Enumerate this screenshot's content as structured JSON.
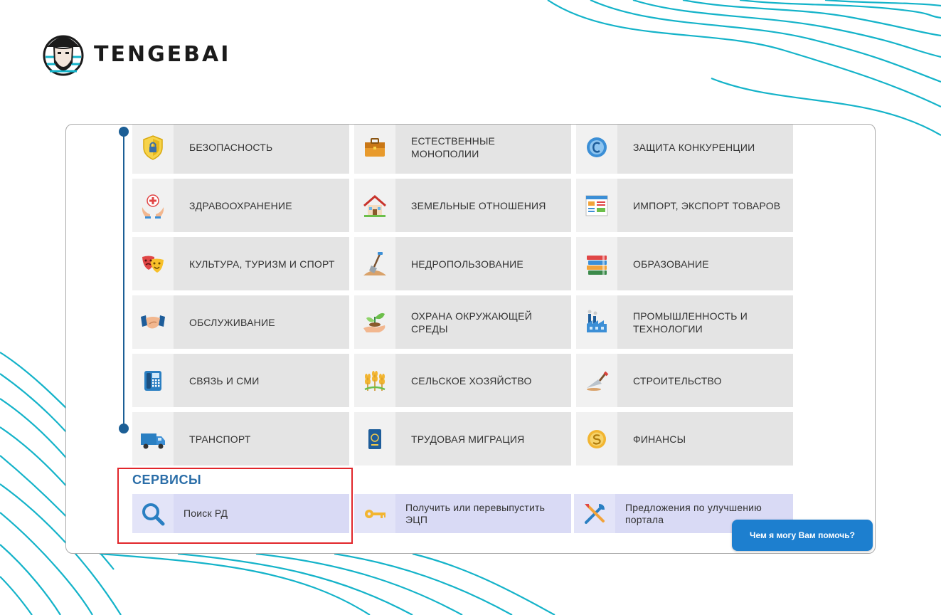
{
  "brand": {
    "name": "TENGEBAI"
  },
  "categories": [
    {
      "label": "БЕЗОПАСНОСТЬ",
      "icon": "shield-lock-icon"
    },
    {
      "label": "ЕСТЕСТВЕННЫЕ МОНОПОЛИИ",
      "icon": "briefcase-icon"
    },
    {
      "label": "ЗАЩИТА КОНКУРЕНЦИИ",
      "icon": "copyright-badge-icon"
    },
    {
      "label": "ЗДРАВООХРАНЕНИЕ",
      "icon": "medical-cross-hands-icon"
    },
    {
      "label": "ЗЕМЕЛЬНЫЕ ОТНОШЕНИЯ",
      "icon": "house-icon"
    },
    {
      "label": "ИМПОРТ, ЭКСПОРТ ТОВАРОВ",
      "icon": "document-list-icon"
    },
    {
      "label": "КУЛЬТУРА, ТУРИЗМ И СПОРТ",
      "icon": "theater-masks-icon"
    },
    {
      "label": "НЕДРОПОЛЬЗОВАНИЕ",
      "icon": "shovel-icon"
    },
    {
      "label": "ОБРАЗОВАНИЕ",
      "icon": "books-icon"
    },
    {
      "label": "ОБСЛУЖИВАНИЕ",
      "icon": "handshake-icon"
    },
    {
      "label": "ОХРАНА ОКРУЖАЮЩЕЙ СРЕДЫ",
      "icon": "plant-hand-icon"
    },
    {
      "label": "ПРОМЫШЛЕННОСТЬ И ТЕХНОЛОГИИ",
      "icon": "factory-icon"
    },
    {
      "label": "СВЯЗЬ И СМИ",
      "icon": "telephone-icon"
    },
    {
      "label": "СЕЛЬСКОЕ ХОЗЯЙСТВО",
      "icon": "wheat-icon"
    },
    {
      "label": "СТРОИТЕЛЬСТВО",
      "icon": "trowel-icon"
    },
    {
      "label": "ТРАНСПОРТ",
      "icon": "truck-icon"
    },
    {
      "label": "ТРУДОВАЯ МИГРАЦИЯ",
      "icon": "passport-icon"
    },
    {
      "label": "ФИНАНСЫ",
      "icon": "coins-icon"
    }
  ],
  "services": {
    "title": "СЕРВИСЫ",
    "items": [
      {
        "label": "Поиск РД",
        "icon": "search-icon"
      },
      {
        "label": "Получить или перевыпустить ЭЦП",
        "icon": "key-icon"
      },
      {
        "label": "Предложения по улучшению портала",
        "icon": "tools-icon"
      }
    ]
  },
  "chat": {
    "label": "Чем я могу Вам помочь?"
  },
  "colors": {
    "accent": "#2b6ea8",
    "timeline": "#1c5f96",
    "highlight": "#e1262b",
    "chat": "#1d7fcf",
    "waves": "#14b3c9"
  }
}
